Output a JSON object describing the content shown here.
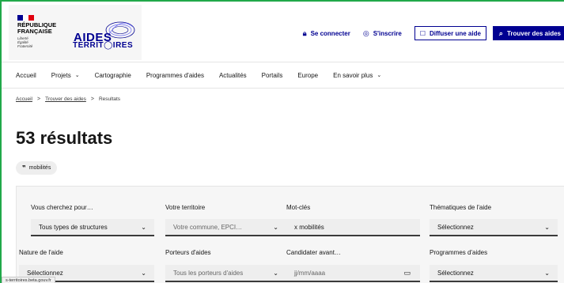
{
  "brand": {
    "republic_line1": "RÉPUBLIQUE",
    "republic_line2": "FRANÇAISE",
    "motto_1": "Liberté",
    "motto_2": "Égalité",
    "motto_3": "Fraternité",
    "logo_line1": "AIDES",
    "logo_line2": "TERRIT◯IRES",
    "flag_colors": [
      "#000091",
      "#ffffff",
      "#e1000f"
    ]
  },
  "header": {
    "login_label": "Se connecter",
    "login_icon": "lock-icon",
    "signup_label": "S'inscrire",
    "signup_icon": "user-circle-icon",
    "publish_label": "Diffuser une aide",
    "publish_icon": "external-box-icon",
    "find_label": "Trouver des aides",
    "find_icon": "search-icon",
    "accent_color": "#000091"
  },
  "nav": {
    "items": [
      {
        "label": "Accueil",
        "has_chevron": false
      },
      {
        "label": "Projets",
        "has_chevron": true
      },
      {
        "label": "Cartographie",
        "has_chevron": false
      },
      {
        "label": "Programmes d'aides",
        "has_chevron": false
      },
      {
        "label": "Actualités",
        "has_chevron": false
      },
      {
        "label": "Portails",
        "has_chevron": false
      },
      {
        "label": "Europe",
        "has_chevron": false
      },
      {
        "label": "En savoir plus",
        "has_chevron": true
      }
    ]
  },
  "breadcrumb": {
    "home": "Accueil",
    "find": "Trouver des aides",
    "current": "Resultats",
    "separator": ">"
  },
  "results": {
    "title": "53 résultats",
    "tag_label": "mobilités"
  },
  "filters": {
    "search_for_label": "Vous cherchez pour…",
    "search_for_value": "Tous types de structures",
    "territory_label": "Votre territoire",
    "territory_placeholder": "Votre commune, EPCI…",
    "keywords_label": "Mot-clés",
    "keywords_value": "x mobilités",
    "themes_label": "Thématiques de l'aide",
    "themes_value": "Sélectionnez",
    "nature_label": "Nature de l'aide",
    "nature_value": "Sélectionnez",
    "backers_label": "Porteurs d'aides",
    "backers_placeholder": "Tous les porteurs d'aides",
    "deadline_label": "Candidater avant…",
    "deadline_placeholder": "jj/mm/aaaa",
    "programs_label": "Programmes d'aides",
    "programs_value": "Sélectionnez"
  },
  "status_bar": {
    "url": "s-territoires.beta.gouv.fr"
  }
}
